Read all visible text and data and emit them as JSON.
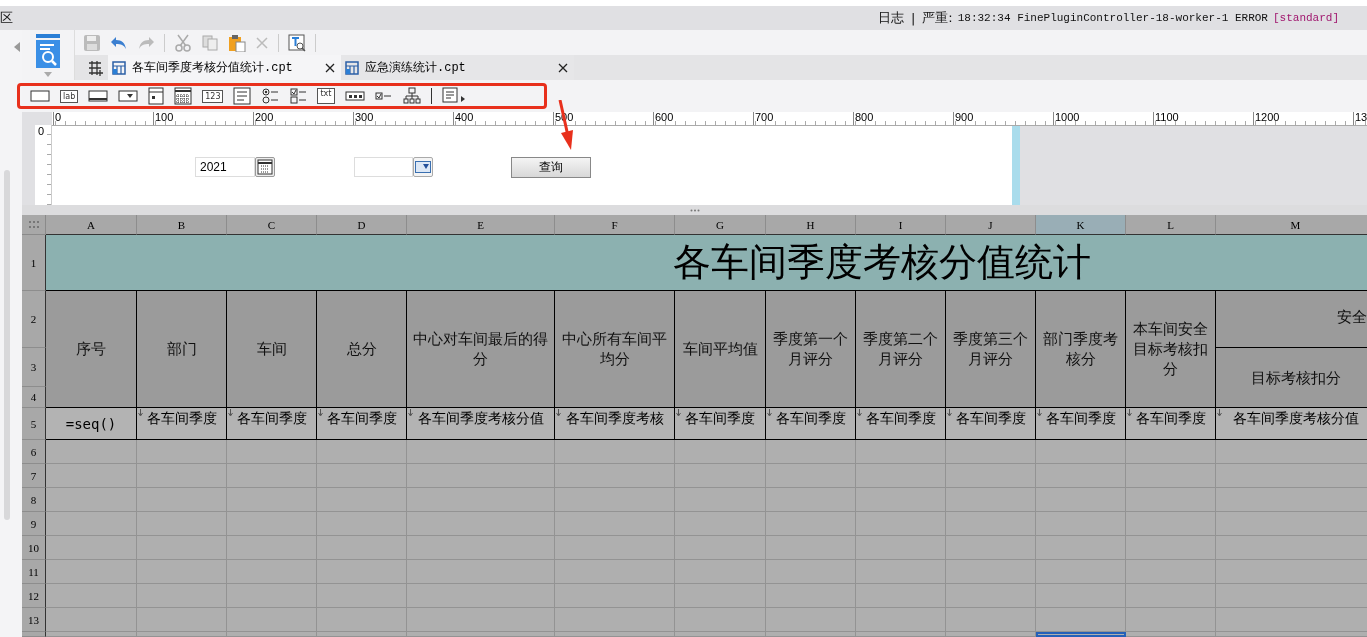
{
  "menu_bar": {
    "left_text": "区",
    "log_label": "日志",
    "separator": "|",
    "log_level": "严重:",
    "log_message": "18:32:34 FinePluginController-18-worker-1 ERROR",
    "log_tag": "[standard]"
  },
  "file_tabs": [
    {
      "label": "各车间季度考核分值统计.cpt",
      "selected": true
    },
    {
      "label": "应急演练统计.cpt",
      "selected": false
    }
  ],
  "widget_toolbar": [
    {
      "kind": "textbox"
    },
    {
      "kind": "label",
      "text": "lab"
    },
    {
      "kind": "button"
    },
    {
      "kind": "combo"
    },
    {
      "kind": "form"
    },
    {
      "kind": "calendar"
    },
    {
      "kind": "number",
      "text": "123"
    },
    {
      "kind": "textarea"
    },
    {
      "kind": "radio"
    },
    {
      "kind": "checkbox"
    },
    {
      "kind": "text",
      "text": "txt"
    },
    {
      "kind": "password"
    },
    {
      "kind": "check"
    },
    {
      "kind": "tree"
    },
    {
      "kind": "more"
    }
  ],
  "ruler": {
    "ticks": [
      "0",
      "100",
      "200",
      "300",
      "400",
      "500",
      "600",
      "700",
      "800",
      "900",
      "1000",
      "1100",
      "1200",
      "13"
    ],
    "vertical_label": "0"
  },
  "form": {
    "year_field": {
      "value": "2021"
    },
    "query_button": "查询"
  },
  "sheet": {
    "columns": [
      {
        "label": "A",
        "selected": false
      },
      {
        "label": "B",
        "selected": false
      },
      {
        "label": "C",
        "selected": false
      },
      {
        "label": "D",
        "selected": false
      },
      {
        "label": "E",
        "selected": false
      },
      {
        "label": "F",
        "selected": false
      },
      {
        "label": "G",
        "selected": false
      },
      {
        "label": "H",
        "selected": false
      },
      {
        "label": "I",
        "selected": false
      },
      {
        "label": "J",
        "selected": false
      },
      {
        "label": "K",
        "selected": true
      },
      {
        "label": "L",
        "selected": false
      },
      {
        "label": "M",
        "selected": false
      }
    ],
    "rows": [
      "1",
      "2",
      "3",
      "4",
      "5",
      "6",
      "7",
      "8",
      "9",
      "10",
      "11",
      "12",
      "13"
    ],
    "title": "各车间季度考核分值统计",
    "headers": [
      "序号",
      "部门",
      "车间",
      "总分",
      "中心对车间最后的得分",
      "中心所有车间平均分",
      "车间平均值",
      "季度第一个月评分",
      "季度第二个月评分",
      "季度第三个月评分",
      "部门季度考核分",
      "本车间安全目标考核扣分"
    ],
    "header_top": "安全",
    "header_sub": "目标考核扣分",
    "row5": [
      {
        "kind": "formula",
        "text": "=seq()"
      },
      {
        "kind": "field",
        "text": "各车间季度"
      },
      {
        "kind": "field",
        "text": "各车间季度"
      },
      {
        "kind": "field",
        "text": "各车间季度"
      },
      {
        "kind": "field",
        "text": "各车间季度考核分值"
      },
      {
        "kind": "field",
        "text": "各车间季度考核"
      },
      {
        "kind": "field",
        "text": "各车间季度"
      },
      {
        "kind": "field",
        "text": "各车间季度"
      },
      {
        "kind": "field",
        "text": "各车间季度"
      },
      {
        "kind": "field",
        "text": "各车间季度"
      },
      {
        "kind": "field",
        "text": "各车间季度"
      },
      {
        "kind": "field",
        "text": "各车间季度"
      },
      {
        "kind": "field",
        "text": "各车间季度考核分值"
      }
    ]
  }
}
